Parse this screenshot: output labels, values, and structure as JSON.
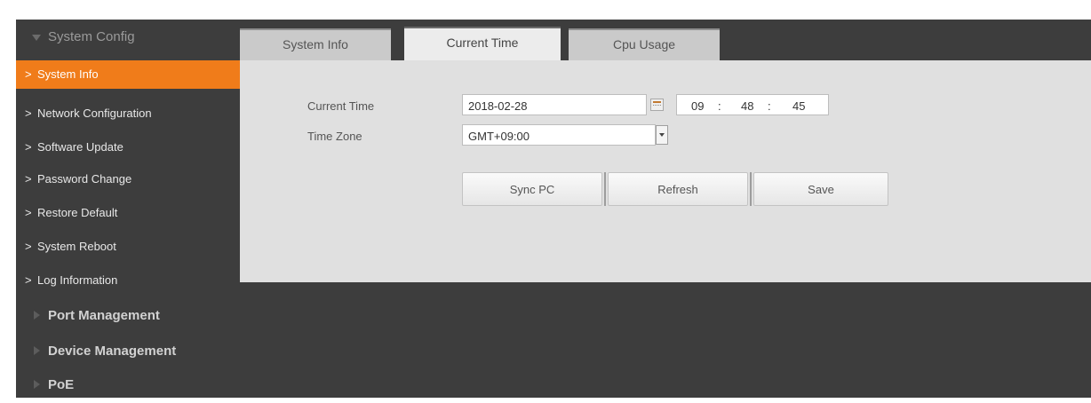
{
  "sidebar": {
    "section_system": "System Config",
    "items": [
      {
        "label": "System Info"
      },
      {
        "label": "Network Configuration"
      },
      {
        "label": "Software Update"
      },
      {
        "label": "Password Change"
      },
      {
        "label": "Restore Default"
      },
      {
        "label": "System Reboot"
      },
      {
        "label": "Log Information"
      }
    ],
    "section_port": "Port Management",
    "section_device": "Device Management",
    "section_poe": "PoE",
    "active_color": "#f07c1a"
  },
  "tabs": [
    {
      "label": "System Info"
    },
    {
      "label": "Current Time"
    },
    {
      "label": "Cpu Usage"
    }
  ],
  "form": {
    "current_time_label": "Current Time",
    "date_value": "2018-02-28",
    "hour": "09",
    "minute": "48",
    "second": "45",
    "time_sep": ":",
    "time_zone_label": "Time Zone",
    "time_zone_value": "GMT+09:00"
  },
  "buttons": {
    "sync_pc": "Sync PC",
    "refresh": "Refresh",
    "save": "Save"
  },
  "icons": {
    "sidebar_chevron": ">",
    "calendar": "calendar-icon",
    "dropdown": "chevron-down-icon"
  }
}
